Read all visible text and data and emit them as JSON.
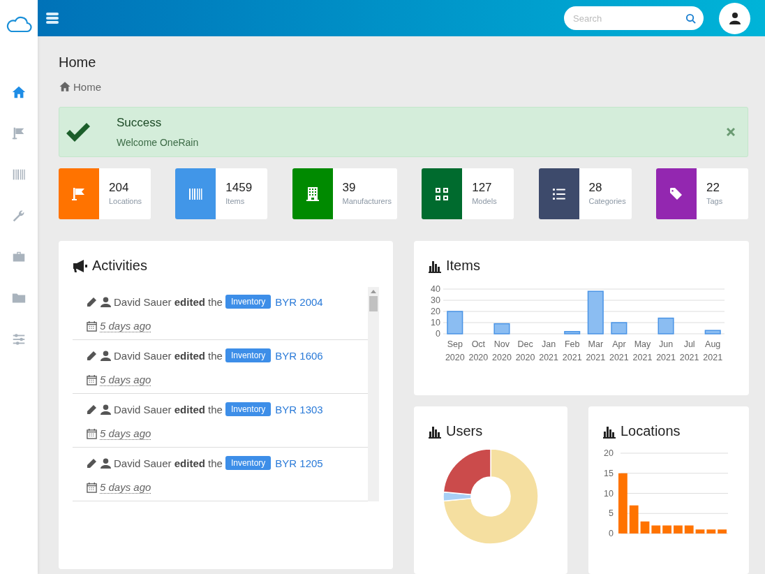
{
  "sidebar": {
    "items": [
      {
        "kind": "home",
        "selected": true
      },
      {
        "kind": "flag",
        "selected": false
      },
      {
        "kind": "barcode",
        "selected": false
      },
      {
        "kind": "wrench",
        "selected": false
      },
      {
        "kind": "briefcase",
        "selected": false
      },
      {
        "kind": "folder",
        "selected": false
      },
      {
        "kind": "sliders",
        "selected": false
      }
    ]
  },
  "header": {
    "search": {
      "placeholder": "Search"
    }
  },
  "page": {
    "title": "Home",
    "breadcrumb": "Home"
  },
  "alert": {
    "title": "Success",
    "message": "Welcome OneRain"
  },
  "stats": [
    {
      "kind": "flag",
      "color": "#ff7300",
      "count": "204",
      "label": "Locations"
    },
    {
      "kind": "barcode",
      "color": "#4196e8",
      "count": "1459",
      "label": "Items"
    },
    {
      "kind": "building",
      "color": "#008a00",
      "count": "39",
      "label": "Manufacturers"
    },
    {
      "kind": "grid",
      "color": "#006b2e",
      "count": "127",
      "label": "Models"
    },
    {
      "kind": "list",
      "color": "#3d4a6b",
      "count": "28",
      "label": "Categories"
    },
    {
      "kind": "tag",
      "color": "#9327b0",
      "count": "22",
      "label": "Tags"
    }
  ],
  "activities": {
    "title": "Activities",
    "items": [
      {
        "text": "David Sauer **edited** the",
        "badge": "Inventory",
        "link": "BYR 2004",
        "time": "5 days ago"
      },
      {
        "text": "David Sauer **edited** the",
        "badge": "Inventory",
        "link": "BYR 1606",
        "time": "5 days ago"
      },
      {
        "text": "David Sauer **edited** the",
        "badge": "Inventory",
        "link": "BYR 1303",
        "time": "5 days ago"
      },
      {
        "text": "David Sauer **edited** the",
        "badge": "Inventory",
        "link": "BYR 1205",
        "time": "5 days ago"
      }
    ]
  },
  "items_chart": {
    "title": "Items",
    "chart_data": {
      "type": "bar",
      "categories": [
        "Sep 2020",
        "Oct 2020",
        "Nov 2020",
        "Dec 2020",
        "Jan 2021",
        "Feb 2021",
        "Mar 2021",
        "Apr 2021",
        "May 2021",
        "Jun 2021",
        "Jul 2021",
        "Aug 2021"
      ],
      "grid": true,
      "series": [
        {
          "color": "#8bbdf2",
          "values": [
            20,
            0,
            9,
            0,
            0,
            2,
            38,
            10,
            0,
            14,
            0,
            3
          ]
        }
      ],
      "ylim": [
        0,
        40
      ],
      "yticks": [
        0,
        10,
        20,
        30,
        40
      ]
    }
  },
  "users_chart": {
    "title": "Users"
  },
  "locations_chart": {
    "title": "Locations",
    "chart_data": {
      "type": "bar",
      "grid": true,
      "series": [
        {
          "color": "#ff7300",
          "values": [
            15,
            7,
            3,
            2,
            2,
            2,
            2,
            1,
            1,
            1
          ]
        }
      ],
      "ylim": [
        0,
        20
      ],
      "yticks": [
        0,
        5,
        10,
        15,
        20
      ]
    }
  }
}
